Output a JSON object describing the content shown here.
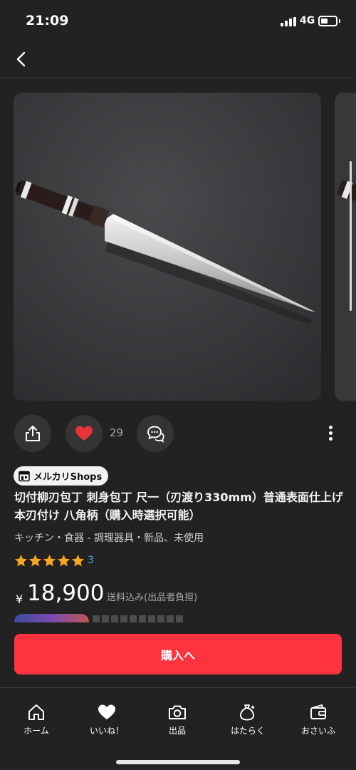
{
  "status_bar": {
    "time": "21:09",
    "network": "4G"
  },
  "nav": {
    "back_icon": "chevron-left-icon"
  },
  "actions": {
    "share_icon": "share-icon",
    "like_icon": "heart-icon",
    "like_count": "29",
    "comment_icon": "comment-icon",
    "more_icon": "more-vertical-icon"
  },
  "item": {
    "shop_badge": "メルカリShops",
    "title": "切付柳刃包丁 刺身包丁 尺一（刃渡り330mm）普通表面仕上げ 本刃付け 八角柄（購入時選択可能）",
    "category": "キッチン・食器 - 調理器具・新品、未使用",
    "rating": 5,
    "review_count": "3",
    "currency_symbol": "¥",
    "price": "18,900",
    "shipping_note": "送料込み(出品者負担)"
  },
  "buy_button": {
    "label": "購入へ"
  },
  "tab_bar": {
    "tabs": [
      {
        "label": "ホーム",
        "icon": "home-icon"
      },
      {
        "label": "いいね！",
        "icon": "heart-icon"
      },
      {
        "label": "出品",
        "icon": "camera-icon"
      },
      {
        "label": "はたらく",
        "icon": "money-bag-icon"
      },
      {
        "label": "おさいふ",
        "icon": "wallet-icon"
      }
    ]
  },
  "colors": {
    "background": "#222222",
    "accent_red": "#ff333f",
    "heart_red": "#e8333a",
    "star_gold": "#f5a623",
    "link_blue": "#4ca3f0"
  }
}
